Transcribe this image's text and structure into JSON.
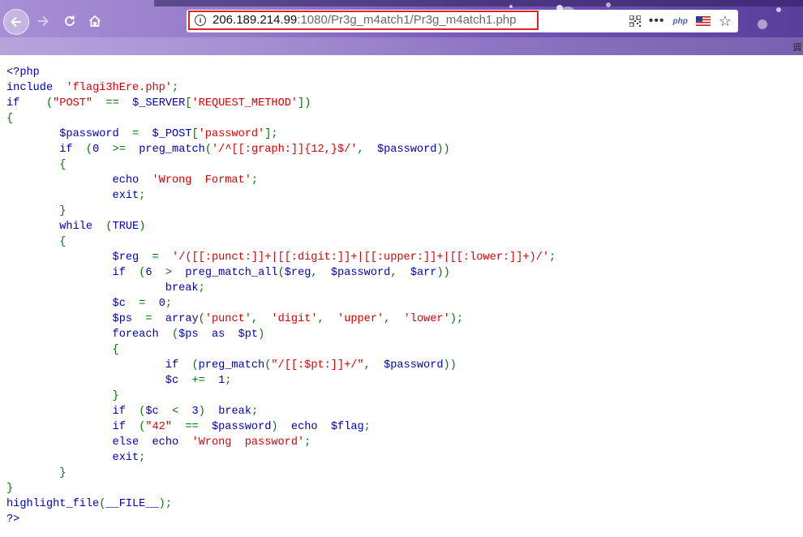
{
  "browser": {
    "url_host": "206.189.214.99",
    "url_rest": ":1080/Pr3g_m4atch1/Pr3g_m4atch1.php",
    "info_icon_glyph": "i",
    "more_glyph": "•••",
    "php_badge": "php",
    "side_glyph": "调"
  },
  "colors": {
    "keyword": "#0000BB",
    "string": "#DD0000",
    "operator": "#007700",
    "highlight_border": "#E02424"
  },
  "code_lines": [
    "<?php",
    "include  'flagi3hEre.php';",
    "if    (\"POST\"  ==  $_SERVER['REQUEST_METHOD'])",
    "{",
    "        $password  =  $_POST['password'];",
    "        if  (0  >=  preg_match('/^[[:graph:]]{12,}$/',  $password))",
    "        {",
    "                echo  'Wrong  Format';",
    "                exit;",
    "        }",
    "        while  (TRUE)",
    "        {",
    "                $reg  =  '/([[:punct:]]+|[[:digit:]]+|[[:upper:]]+|[[:lower:]]+)/';",
    "                if  (6  >  preg_match_all($reg,  $password,  $arr))",
    "                        break;",
    "                $c  =  0;",
    "                $ps  =  array('punct',  'digit',  'upper',  'lower');",
    "                foreach  ($ps  as  $pt)",
    "                {",
    "                        if  (preg_match(\"/[[:$pt:]]+/\",  $password))",
    "                        $c  +=  1;",
    "                }",
    "                if  ($c  <  3)  break;",
    "                if  (\"42\"  ==  $password)  echo  $flag;",
    "                else  echo  'Wrong  password';",
    "                exit;",
    "        }",
    "}",
    "highlight_file(__FILE__);",
    "?>"
  ]
}
